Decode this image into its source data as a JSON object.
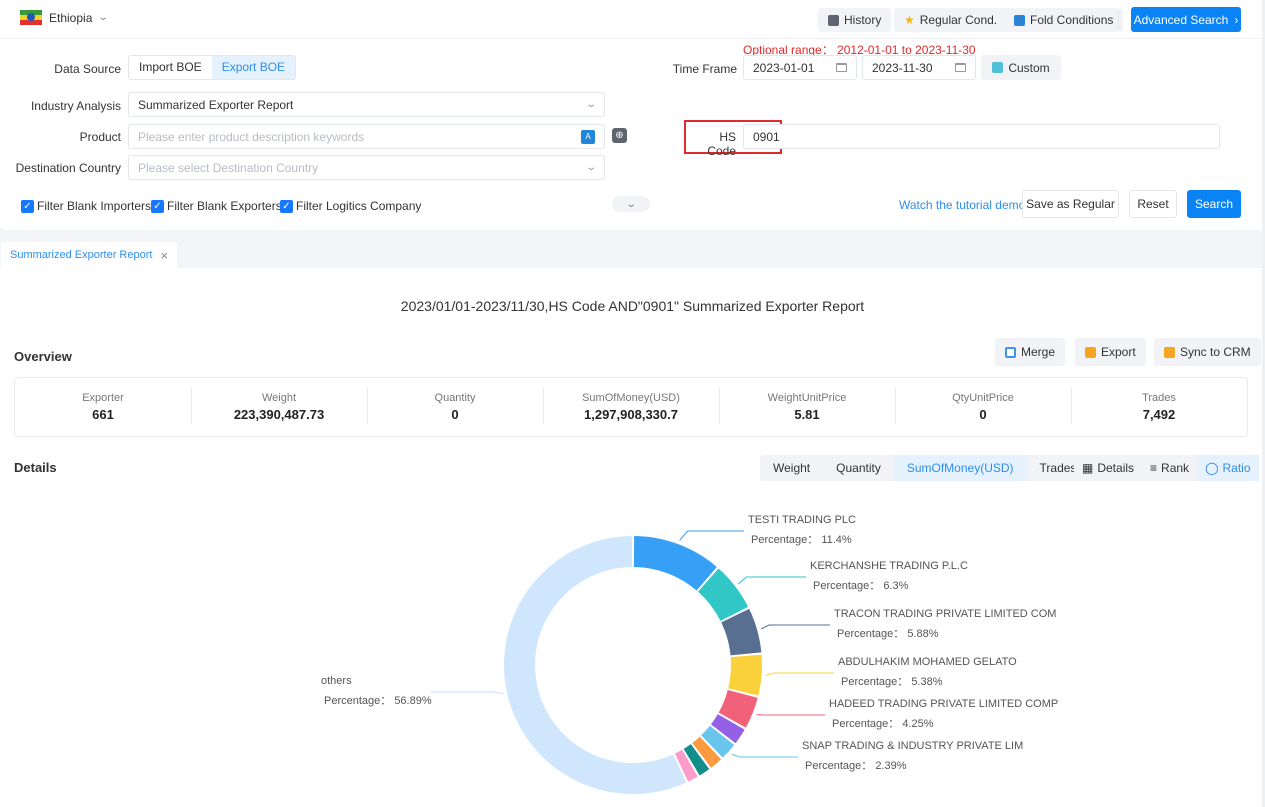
{
  "topbar": {
    "country": "Ethiopia",
    "history": "History",
    "regular_cond": "Regular Cond.",
    "fold_conditions": "Fold Conditions",
    "advanced_search": "Advanced Search"
  },
  "form": {
    "data_source_label": "Data Source",
    "data_source_options": [
      "Import BOE",
      "Export BOE"
    ],
    "data_source_selected": "Export BOE",
    "optional_range": "Optional range： 2012-01-01 to 2023-11-30",
    "time_frame_label": "Time Frame",
    "date_start": "2023-01-01",
    "date_end": "2023-11-30",
    "custom_label": "Custom",
    "industry_label": "Industry Analysis",
    "industry_value": "Summarized Exporter Report",
    "product_label": "Product",
    "product_placeholder": "Please enter product description keywords",
    "hs_label": "HS Code",
    "hs_value": "0901",
    "dest_label": "Destination Country",
    "dest_placeholder": "Please select Destination Country",
    "filters": [
      {
        "label": "Filter Blank Importers",
        "checked": true
      },
      {
        "label": "Filter Blank Exporters",
        "checked": true
      },
      {
        "label": "Filter Logitics Company",
        "checked": true
      }
    ],
    "tutorial_link": "Watch the tutorial demo",
    "save_regular": "Save as Regular",
    "reset": "Reset",
    "search": "Search"
  },
  "tab": {
    "label": "Summarized Exporter Report"
  },
  "report": {
    "title": "2023/01/01-2023/11/30,HS Code AND\"0901\" Summarized Exporter Report",
    "overview_title": "Overview",
    "merge": "Merge",
    "export": "Export",
    "sync_crm": "Sync to CRM",
    "stats": [
      {
        "key": "Exporter",
        "value": "661"
      },
      {
        "key": "Weight",
        "value": "223,390,487.73"
      },
      {
        "key": "Quantity",
        "value": "0"
      },
      {
        "key": "SumOfMoney(USD)",
        "value": "1,297,908,330.7"
      },
      {
        "key": "WeightUnitPrice",
        "value": "5.81"
      },
      {
        "key": "QtyUnitPrice",
        "value": "0"
      },
      {
        "key": "Trades",
        "value": "7,492"
      }
    ],
    "details_title": "Details",
    "metric_tabs": [
      "Weight",
      "Quantity",
      "SumOfMoney(USD)",
      "Trades"
    ],
    "metric_selected": "SumOfMoney(USD)",
    "view_tabs": [
      "Details",
      "Rank",
      "Ratio"
    ],
    "view_selected": "Ratio"
  },
  "chart_data": {
    "type": "pie",
    "variant": "donut",
    "label_prefix": "Percentage： ",
    "slices": [
      {
        "name": "TESTI TRADING PLC",
        "value": 11.4,
        "color": "#369ff6",
        "labeled": true
      },
      {
        "name": "KERCHANSHE TRADING P.L.C",
        "value": 6.3,
        "color": "#30c7c6",
        "labeled": true
      },
      {
        "name": "TRACON TRADING PRIVATE LIMITED COM",
        "value": 5.88,
        "color": "#586f92",
        "labeled": true
      },
      {
        "name": "ABDULHAKIM MOHAMED GELATO",
        "value": 5.38,
        "color": "#fbd13b",
        "labeled": true
      },
      {
        "name": "HADEED TRADING PRIVATE LIMITED COMP",
        "value": 4.25,
        "color": "#f2617a",
        "labeled": true
      },
      {
        "name": "",
        "value": 2.3,
        "color": "#9460e6",
        "labeled": false
      },
      {
        "name": "SNAP TRADING & INDUSTRY PRIVATE LIM",
        "value": 2.39,
        "color": "#6ac5ec",
        "labeled": true
      },
      {
        "name": "",
        "value": 1.9,
        "color": "#fb9a3f",
        "labeled": false
      },
      {
        "name": "",
        "value": 1.7,
        "color": "#148e8c",
        "labeled": false
      },
      {
        "name": "",
        "value": 1.61,
        "color": "#fb9ccb",
        "labeled": false
      },
      {
        "name": "others",
        "value": 56.89,
        "color": "#cfe6fd",
        "labeled": true
      }
    ]
  }
}
